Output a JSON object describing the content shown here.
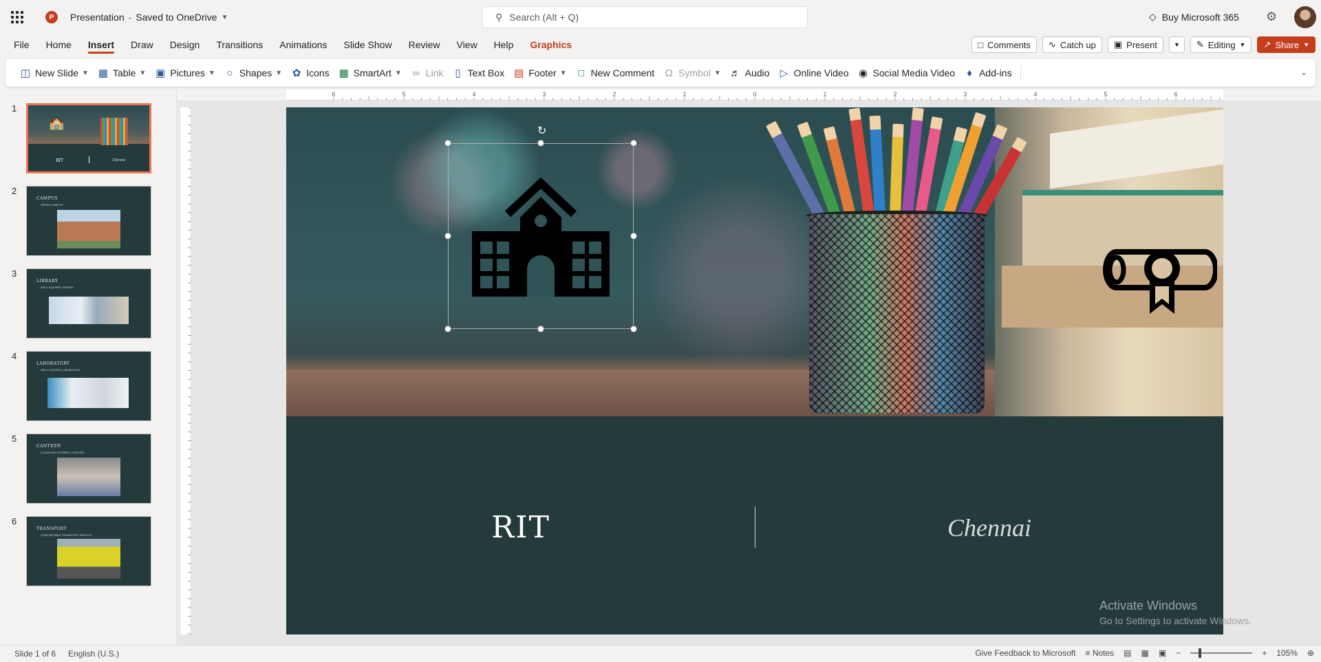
{
  "titlebar": {
    "doc_title": "Presentation",
    "separator": "-",
    "save_status": "Saved to OneDrive",
    "search_placeholder": "Search (Alt + Q)",
    "buy": "Buy Microsoft 365"
  },
  "menu": {
    "tabs": [
      "File",
      "Home",
      "Insert",
      "Draw",
      "Design",
      "Transitions",
      "Animations",
      "Slide Show",
      "Review",
      "View",
      "Help",
      "Graphics"
    ],
    "active": "Insert",
    "right": {
      "comments": "Comments",
      "catch_up": "Catch up",
      "present": "Present",
      "editing": "Editing",
      "share": "Share"
    }
  },
  "ribbon": {
    "new_slide": "New Slide",
    "table": "Table",
    "pictures": "Pictures",
    "shapes": "Shapes",
    "icons": "Icons",
    "smartart": "SmartArt",
    "link": "Link",
    "text_box": "Text Box",
    "footer": "Footer",
    "new_comment": "New Comment",
    "symbol": "Symbol",
    "audio": "Audio",
    "online_video": "Online Video",
    "social_media_video": "Social Media Video",
    "add_ins": "Add-ins"
  },
  "thumbnails": [
    {
      "num": "1",
      "title": "RIT",
      "sub": "Chennai",
      "selected": true
    },
    {
      "num": "2",
      "title": "CAMPUS",
      "sub": "GREEN CAMPUS"
    },
    {
      "num": "3",
      "title": "LIBRARY",
      "sub": "WELL EQUIPED LIBRARY"
    },
    {
      "num": "4",
      "title": "LABORATORY",
      "sub": "WELL EQUIPED LABORATORY"
    },
    {
      "num": "5",
      "title": "CANTEEN",
      "sub": "CLEAN AND HYGIENIC CANTEEN"
    },
    {
      "num": "6",
      "title": "TRANSPORT",
      "sub": "COMFORTABLE TRANSPORT SERVICE"
    }
  ],
  "ruler": {
    "h_ticks": [
      "6",
      "5",
      "4",
      "3",
      "2",
      "1",
      "0",
      "1",
      "2",
      "3",
      "4",
      "5",
      "6"
    ]
  },
  "slide": {
    "title": "RIT",
    "subtitle": "Chennai"
  },
  "watermark": {
    "line1": "Activate Windows",
    "line2": "Go to Settings to activate Windows."
  },
  "status": {
    "slide_info": "Slide 1 of 6",
    "language": "English (U.S.)",
    "feedback": "Give Feedback to Microsoft",
    "notes": "Notes",
    "zoom": "105%"
  },
  "colors": {
    "accent": "#c43e1c",
    "slide_bg": "#243a3b",
    "selected_thumb": "#ed7354"
  }
}
